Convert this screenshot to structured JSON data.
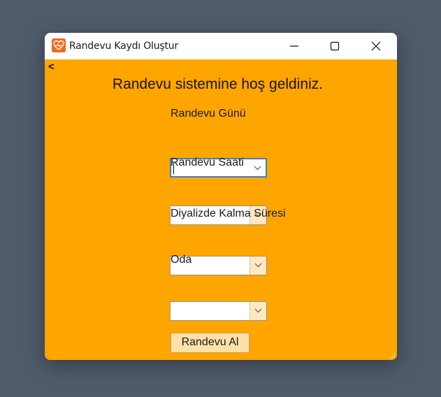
{
  "window": {
    "title": "Randevu Kaydı Oluştur",
    "icon": "heart-logo-icon",
    "controls": [
      "minimize-icon",
      "maximize-icon",
      "close-icon"
    ]
  },
  "content": {
    "back_label": "<",
    "heading": "Randevu sistemine hoş geldiniz.",
    "fields": [
      {
        "label": "Randevu Günü",
        "value": ""
      },
      {
        "label": "Randevu Saati",
        "value": ""
      },
      {
        "label": "Diyalizde Kalma Süresi",
        "value": ""
      },
      {
        "label": "Oda",
        "value": ""
      }
    ],
    "submit_label": "Randevu Al"
  },
  "colors": {
    "background": "#ffa500",
    "desktop": "#4f5b6b",
    "focus_border": "#3b7fc4",
    "button_bg": "#ffe1a8"
  }
}
